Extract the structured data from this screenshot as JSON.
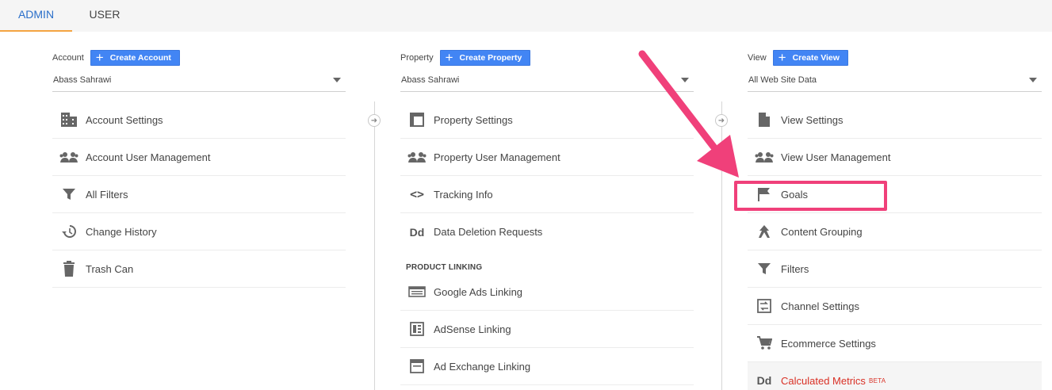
{
  "tabs": [
    {
      "label": "ADMIN",
      "active": true
    },
    {
      "label": "USER",
      "active": false
    }
  ],
  "account": {
    "label": "Account",
    "create_label": "Create Account",
    "selected": "Abass Sahrawi",
    "items": [
      {
        "label": "Account Settings",
        "icon": "building-icon"
      },
      {
        "label": "Account User Management",
        "icon": "people-icon"
      },
      {
        "label": "All Filters",
        "icon": "filter-icon"
      },
      {
        "label": "Change History",
        "icon": "history-icon"
      },
      {
        "label": "Trash Can",
        "icon": "trash-icon"
      }
    ]
  },
  "property": {
    "label": "Property",
    "create_label": "Create Property",
    "selected": "Abass Sahrawi",
    "items": [
      {
        "label": "Property Settings",
        "icon": "window-icon"
      },
      {
        "label": "Property User Management",
        "icon": "people-icon"
      },
      {
        "label": "Tracking Info",
        "icon": "code-icon"
      },
      {
        "label": "Data Deletion Requests",
        "icon": "dd-icon"
      }
    ],
    "product_linking_label": "PRODUCT LINKING",
    "linking_items": [
      {
        "label": "Google Ads Linking",
        "icon": "ads-icon"
      },
      {
        "label": "AdSense Linking",
        "icon": "adsense-icon"
      },
      {
        "label": "Ad Exchange Linking",
        "icon": "adexchange-icon"
      }
    ]
  },
  "view": {
    "label": "View",
    "create_label": "Create View",
    "selected": "All Web Site Data",
    "items": [
      {
        "label": "View Settings",
        "icon": "document-icon"
      },
      {
        "label": "View User Management",
        "icon": "people-icon"
      },
      {
        "label": "Goals",
        "icon": "flag-icon"
      },
      {
        "label": "Content Grouping",
        "icon": "content-grouping-icon"
      },
      {
        "label": "Filters",
        "icon": "filter-icon"
      },
      {
        "label": "Channel Settings",
        "icon": "channel-icon"
      },
      {
        "label": "Ecommerce Settings",
        "icon": "cart-icon"
      },
      {
        "label": "Calculated Metrics",
        "icon": "dd-icon",
        "badge": "BETA"
      }
    ]
  },
  "icon_glyphs": {
    "dd": "Dd",
    "code": "<>",
    "transfer_arrow": "➜"
  },
  "colors": {
    "tab_active": "#2a6fc9",
    "tab_underline": "#f4a442",
    "button": "#4285f4",
    "highlight": "#f0407a",
    "calculated_metrics": "#d93025"
  }
}
